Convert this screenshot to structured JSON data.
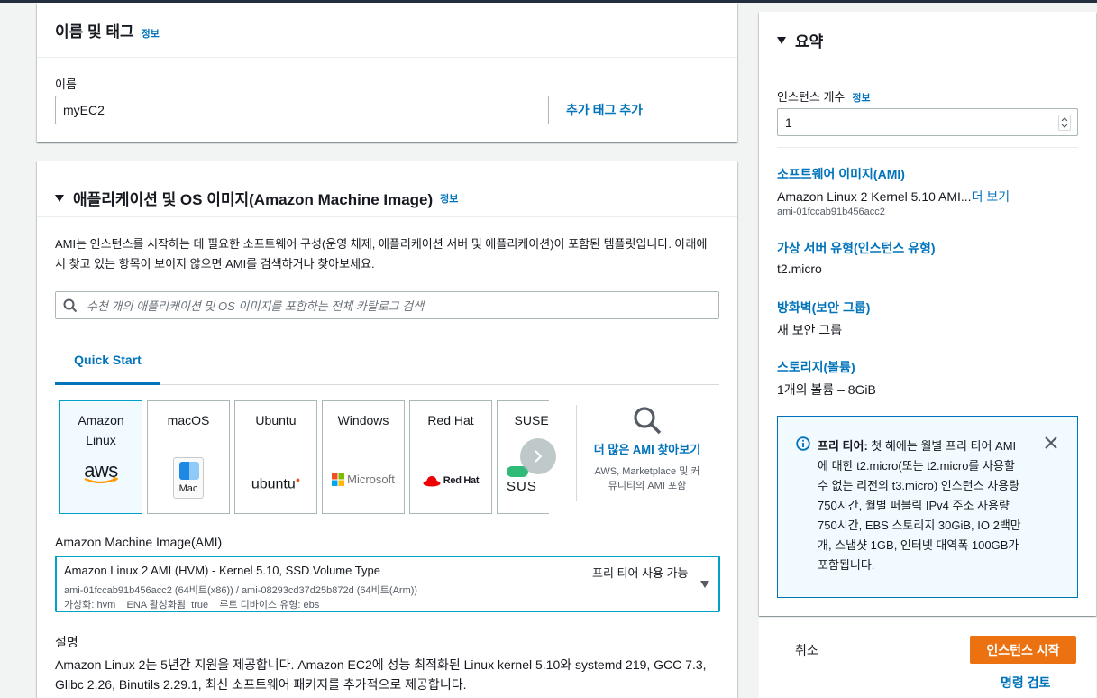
{
  "name_tags": {
    "title": "이름 및 태그",
    "info": "정보",
    "name_label": "이름",
    "name_value": "myEC2",
    "add_tags": "추가 태그 추가"
  },
  "ami": {
    "title": "애플리케이션 및 OS 이미지(Amazon Machine Image)",
    "info": "정보",
    "description_line1": "AMI는 인스턴스를 시작하는 데 필요한 소프트웨어 구성(운영 체제, 애플리케이션 서버 및 애플리케이션)이 포함된 템플릿입니다. 아래에",
    "description_line2": "서 찾고 있는 항목이 보이지 않으면 AMI를 검색하거나 찾아보세요.",
    "search_placeholder": "수천 개의 애플리케이션 및 OS 이미지를 포함하는 전체 카탈로그 검색",
    "tab_quick_start": "Quick Start",
    "os_options": [
      {
        "label_line1": "Amazon",
        "label_line2": "Linux",
        "logo": "aws"
      },
      {
        "label_line1": "macOS",
        "logo": "Mac"
      },
      {
        "label_line1": "Ubuntu",
        "logo": "ubuntu"
      },
      {
        "label_line1": "Windows",
        "logo": "Microsoft"
      },
      {
        "label_line1": "Red Hat",
        "logo": "Red Hat"
      },
      {
        "label_line1": "SUSE Li",
        "logo": "SUS"
      }
    ],
    "browse_more": "더 많은 AMI 찾아보기",
    "browse_sub_line1": "AWS, Marketplace 및 커",
    "browse_sub_line2": "뮤니티의 AMI 포함",
    "ami_label": "Amazon Machine Image(AMI)",
    "selected_ami": {
      "name": "Amazon Linux 2 AMI (HVM) - Kernel 5.10, SSD Volume Type",
      "free_tier": "프리 티어 사용 가능",
      "ids": "ami-01fccab91b456acc2 (64비트(x86)) / ami-08293cd37d25b872d (64비트(Arm))",
      "meta_virt": "가상화: hvm",
      "meta_ena": "ENA 활성화됨: true",
      "meta_root": "루트 디바이스 유형: ebs"
    },
    "desc_label": "설명",
    "desc_line1": "Amazon Linux 2는 5년간 지원을 제공합니다. Amazon EC2에 성능 최적화된 Linux kernel 5.10와 systemd 219, GCC 7.3,",
    "desc_line2": "Glibc 2.26, Binutils 2.29.1, 최신 소프트웨어 패키지를 추가적으로 제공합니다."
  },
  "summary": {
    "title": "요약",
    "instances_label": "인스턴스 개수",
    "info": "정보",
    "instances_value": "1",
    "software_title": "소프트웨어 이미지(AMI)",
    "software_value": "Amazon Linux 2 Kernel 5.10 AMI...",
    "software_more": "더 보기",
    "software_id": "ami-01fccab91b456acc2",
    "type_title": "가상 서버 유형(인스턴스 유형)",
    "type_value": "t2.micro",
    "firewall_title": "방화벽(보안 그룹)",
    "firewall_value": "새 보안 그룹",
    "storage_title": "스토리지(볼륨)",
    "storage_value": "1개의 볼륨 – 8GiB",
    "free_tier_bold": "프리 티어:",
    "free_tier_lines": [
      " 첫 해에는 월별 프리 티어 AMI",
      "에 대한 t2.micro(또는 t2.micro를 사용할",
      "수 없는 리전의 t3.micro) 인스턴스 사용량",
      "750시간, 월별 퍼블릭 IPv4 주소 사용량",
      "750시간, EBS 스토리지 30GiB, IO 2백만",
      "개, 스냅샷 1GB, 인터넷 대역폭 100GB가",
      "포함됩니다."
    ]
  },
  "footer": {
    "cancel": "취소",
    "launch": "인스턴스 시작",
    "review": "명령 검토"
  },
  "colors": {
    "accent": "#0073bb",
    "primary_button": "#ec7211",
    "selected_border": "#00a1c9"
  }
}
